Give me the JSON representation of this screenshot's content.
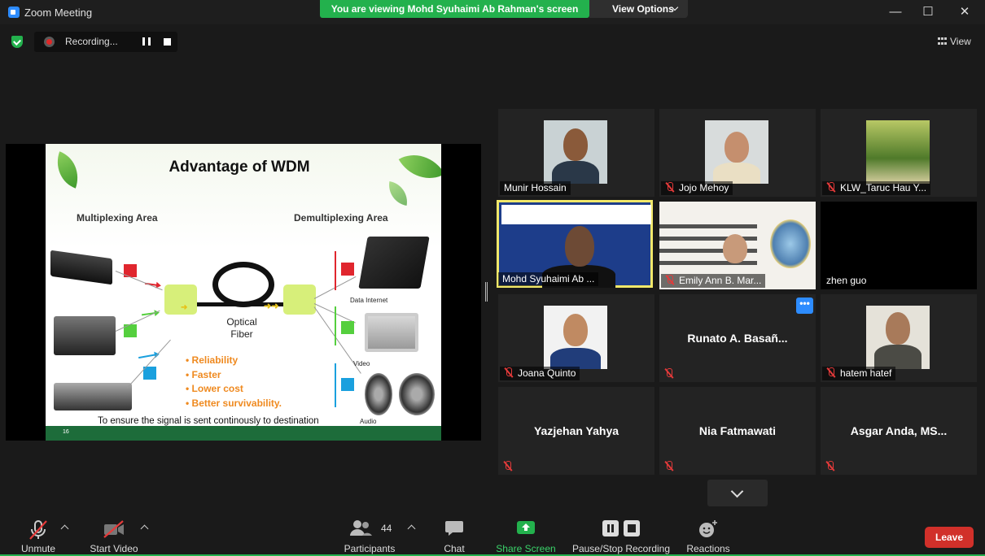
{
  "window": {
    "title": "Zoom Meeting",
    "share_banner": "You are viewing Mohd Syuhaimi Ab Rahman's screen",
    "view_options": "View Options",
    "controls": {
      "minimize": "—",
      "maximize": "☐",
      "close": "✕"
    }
  },
  "recording": {
    "label": "Recording..."
  },
  "view_button": {
    "label": "View"
  },
  "slide": {
    "title": "Advantage of WDM",
    "left_area": "Multiplexing Area",
    "right_area": "Demultiplexing Area",
    "fiber_label_1": "Optical",
    "fiber_label_2": "Fiber",
    "bullets": [
      "•  Reliability",
      "•  Faster",
      "•  Lower cost",
      "•  Better survivability."
    ],
    "devices": {
      "laptop": "Data Internet",
      "monitor": "Video",
      "speakers": "Audio"
    },
    "footnote": "To ensure the signal is sent continously to destination",
    "page": "16",
    "colors": {
      "red": "#e0262e",
      "green": "#55cf3e",
      "blue": "#1aa0de"
    }
  },
  "participants": [
    {
      "name": "Munir Hossain",
      "muted": false,
      "video": true
    },
    {
      "name": "Jojo Mehoy",
      "muted": true,
      "video": true
    },
    {
      "name": "KLW_Taruc Hau Y...",
      "muted": true,
      "video": true
    },
    {
      "name": "Mohd Syuhaimi Ab ...",
      "muted": false,
      "video": true,
      "active": true
    },
    {
      "name": "Emily Ann B. Mar...",
      "muted": true,
      "video": true
    },
    {
      "name": "zhen guo",
      "muted": false,
      "video": false
    },
    {
      "name": "Joana Quinto",
      "muted": true,
      "video": true
    },
    {
      "name": "Runato A. Basañ...",
      "muted": true,
      "video": false
    },
    {
      "name": "hatem hatef",
      "muted": true,
      "video": true
    },
    {
      "name": "Yazjehan Yahya",
      "muted": true,
      "video": false
    },
    {
      "name": "Nia Fatmawati",
      "muted": true,
      "video": false
    },
    {
      "name": "Asgar Anda, MS...",
      "muted": true,
      "video": false
    }
  ],
  "more_button": "•••",
  "toolbar": {
    "unmute": "Unmute",
    "start_video": "Start Video",
    "participants": "Participants",
    "participants_count": "44",
    "chat": "Chat",
    "share_screen": "Share Screen",
    "pause_stop": "Pause/Stop Recording",
    "reactions": "Reactions",
    "leave": "Leave"
  }
}
